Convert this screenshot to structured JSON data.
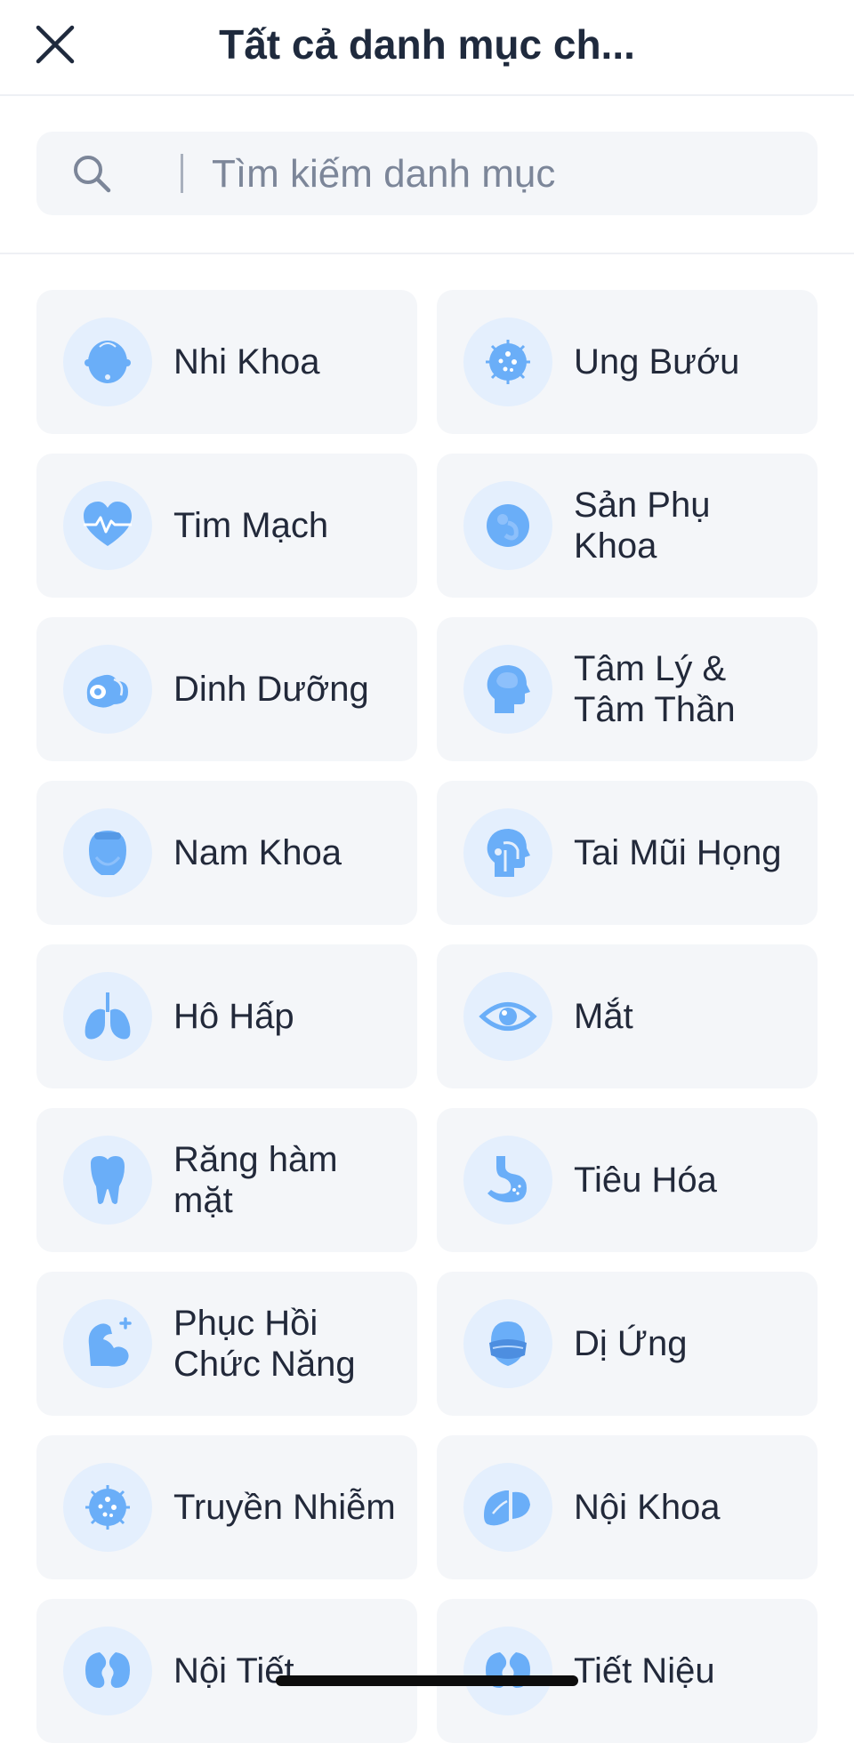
{
  "header": {
    "title": "Tất cả danh mục ch...",
    "close_icon": "close-icon"
  },
  "search": {
    "placeholder": "Tìm kiếm danh mục",
    "value": "",
    "icon": "search-icon"
  },
  "colors": {
    "accent": "#6aaef8",
    "icon_bg": "#e4effd",
    "card_bg": "#f4f6f9",
    "text": "#22293a"
  },
  "categories": [
    {
      "label": "Nhi Khoa",
      "icon": "baby-head-icon"
    },
    {
      "label": "Ung Bướu",
      "icon": "tumor-cell-icon"
    },
    {
      "label": "Tim Mạch",
      "icon": "heart-pulse-icon"
    },
    {
      "label": "Sản Phụ Khoa",
      "icon": "fetus-icon"
    },
    {
      "label": "Dinh Dưỡng",
      "icon": "food-icon"
    },
    {
      "label": "Tâm Lý & Tâm Thần",
      "icon": "head-brain-icon"
    },
    {
      "label": "Nam Khoa",
      "icon": "male-head-icon"
    },
    {
      "label": "Tai Mũi Họng",
      "icon": "ent-head-icon"
    },
    {
      "label": "Hô Hấp",
      "icon": "lungs-icon"
    },
    {
      "label": "Mắt",
      "icon": "eye-icon"
    },
    {
      "label": "Răng hàm mặt",
      "icon": "tooth-icon"
    },
    {
      "label": "Tiêu Hóa",
      "icon": "stomach-icon"
    },
    {
      "label": "Phục Hồi Chức Năng",
      "icon": "muscle-arm-icon"
    },
    {
      "label": "Dị Ứng",
      "icon": "mask-face-icon"
    },
    {
      "label": "Truyền Nhiễm",
      "icon": "virus-icon"
    },
    {
      "label": "Nội Khoa",
      "icon": "organ-icon"
    },
    {
      "label": "Nội Tiết",
      "icon": "kidney-icon"
    },
    {
      "label": "Tiết Niệu",
      "icon": "kidneys-icon"
    }
  ]
}
